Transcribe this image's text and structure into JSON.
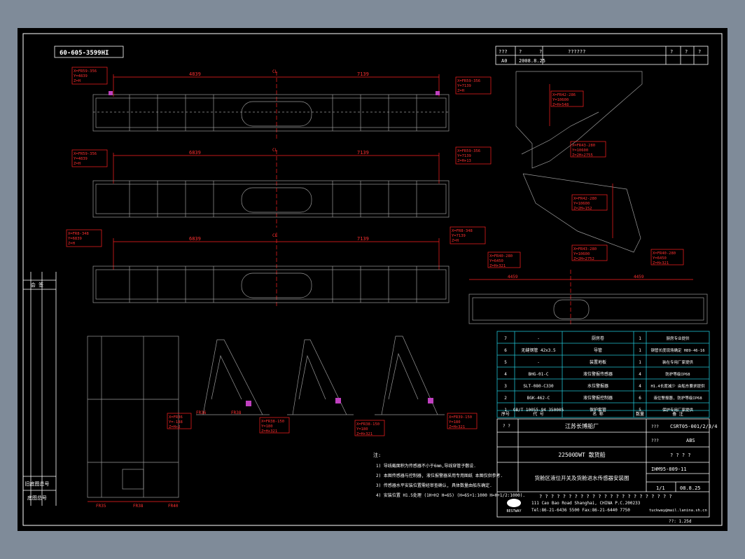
{
  "drawing_no_top": "60-605-3599HI",
  "top_table": {
    "r1": [
      "???",
      "?",
      "?",
      "??????",
      "?",
      "?",
      "?"
    ],
    "r2": [
      "A0",
      "2008.8.25"
    ]
  },
  "dims": {
    "d1_left": "4839",
    "d1_right": "7139",
    "cl": "CL",
    "d2_left": "6839",
    "d2_right": "7139",
    "d3_left": "6839",
    "d3_right": "7139",
    "d4_left": "4459",
    "d4_right": "4459"
  },
  "callouts": {
    "c1": [
      "X=FR59-356",
      "Y=4839",
      "Z=H"
    ],
    "c2": [
      "X=FR59-356",
      "Y=7139",
      "Z=H"
    ],
    "c3": [
      "X=FR59-356",
      "Y=4839",
      "Z=H"
    ],
    "c4": [
      "X=FR59-356",
      "Y=7139",
      "Z=H+13"
    ],
    "c5": [
      "X=FR8-348",
      "Y=6839",
      "Z=H"
    ],
    "c6": [
      "X=FR8-348",
      "Y=7139",
      "Z=H"
    ],
    "c7": [
      "X=FR42-286",
      "Y=10600",
      "Z=H+548"
    ],
    "c8": [
      "X=FR43-280",
      "Y=10600",
      "Z=2H+2755"
    ],
    "c9": [
      "X=FR42-280",
      "Y=10600",
      "Z=2H+152"
    ],
    "c10": [
      "X=FR43-280",
      "Y=10600",
      "Z=2H+2752"
    ],
    "c11": [
      "X=FR40-280",
      "Y=6450",
      "Z=H+321"
    ],
    "c12": [
      "X=FR40-280",
      "Y=6450",
      "Z=H+321"
    ],
    "c13": [
      "X=FR36",
      "Y=-188",
      "Z=H+2"
    ],
    "c14": [
      "X=FR38-150",
      "Y=180",
      "Z=H+321"
    ],
    "c15": [
      "X=FR38-150",
      "Y=180",
      "Z=H+321"
    ],
    "c16": [
      "X=FR39-150",
      "Y=180",
      "Z=H+321"
    ]
  },
  "frames": [
    "FR35",
    "FR38",
    "FR40",
    "FR36",
    "FR38"
  ],
  "left_strip": [
    "会 签",
    "旧底图总号",
    "底图总号"
  ],
  "parts_table": {
    "rows": [
      [
        "7",
        "-",
        "厨房卷",
        "1",
        "厨房专业提供"
      ],
      [
        "6",
        "无缝钢管 42x3.5",
        "导管",
        "1",
        "钢管长度现场确定 H89-46-16"
      ],
      [
        "5",
        "-",
        "装置地板",
        "1",
        "装在专用厂家提供"
      ],
      [
        "4",
        "BHG-01-C",
        "液位警报传感器",
        "4",
        "防护等级IP68"
      ],
      [
        "3",
        "SLT-080-C330",
        "水位警报器",
        "4",
        "H1.4长度减少 由船东要求提供"
      ],
      [
        "2",
        "BGK-462-C",
        "液位警报控制器",
        "6",
        "液位警报器, 防护等级IP68"
      ],
      [
        "1",
        "GB/T 10055-94 350005",
        "保护套管",
        "5",
        "保护专用厂家提供"
      ]
    ],
    "footer": [
      "序号",
      "代 号",
      "名 称",
      "数量",
      "备 注"
    ]
  },
  "title_block": {
    "company": "江苏长博船厂",
    "code1_label": "???",
    "code1": "CSRT05-001/2/3/4",
    "code2_label": "???",
    "code2": "ABS",
    "ship": "22500DWT 散货船",
    "ship_r": "? ? ? ?",
    "title": "货舱区液位开关及货舱进水传感器安装图",
    "dwg_no": "IHM95-809-11",
    "ratio": "1/1",
    "date": "08.8.25",
    "addr_q": "? ? ? ? ? ? ? ? ? ? ? ? ? ? ? ? ? ? ? ? ? ? ?",
    "address": "111 Cao Bao Road Shanghai, CHINA   P.C.200233",
    "tel": "Tel:86-21-6436 5500  Fax:86-21-6440 7750",
    "email": "tuckway@mail.lanina.sh.cn",
    "brand": "BESTWAY",
    "sheet_label": "??: 1.25d"
  },
  "notes": {
    "title": "注:",
    "lines": [
      "1) 导线截面积为传感器不小于6mm,导线穿管子敷设.",
      "2) 本图传感器与控制器, 液位报警器采用专用图纸 本图仅供参考.",
      "3) 传感器水平安装位置需经审查确认, 具体数量由船东确定.",
      "4) 安装位置 H1.5处理 (1H+H2 H=65)  (H=65+1:1000 H=H+1/2:1000)."
    ]
  }
}
